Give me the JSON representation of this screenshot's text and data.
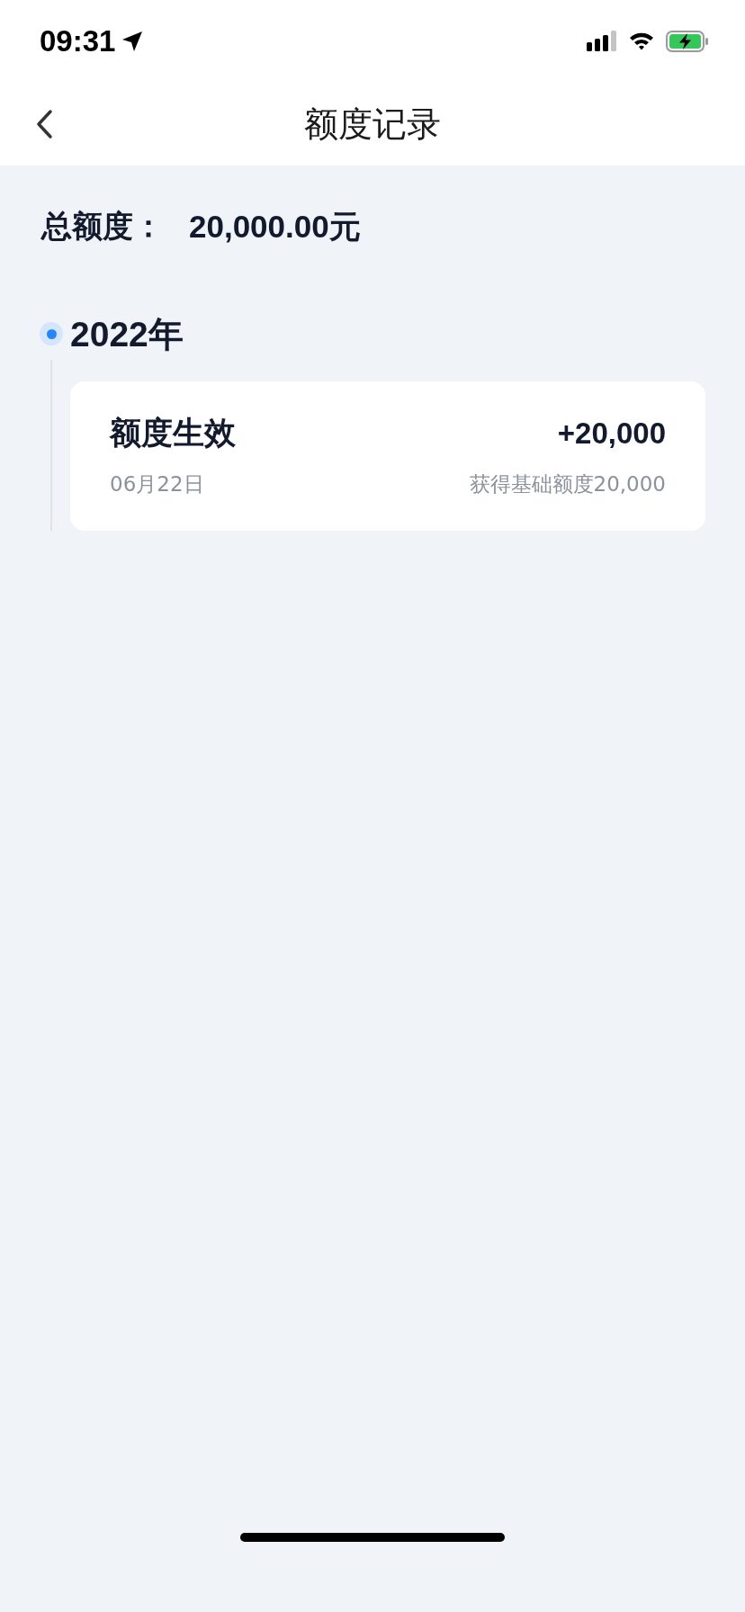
{
  "status_bar": {
    "time": "09:31"
  },
  "nav": {
    "title": "额度记录"
  },
  "total": {
    "label": "总额度：",
    "value": "20,000.00元"
  },
  "groups": [
    {
      "year": "2022年",
      "records": [
        {
          "title": "额度生效",
          "amount": "+20,000",
          "date": "06月22日",
          "note": "获得基础额度20,000"
        }
      ]
    }
  ]
}
